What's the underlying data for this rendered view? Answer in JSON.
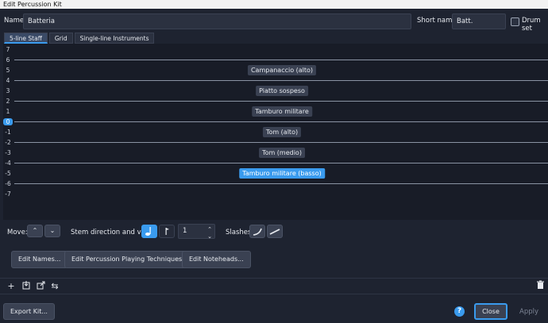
{
  "window": {
    "title": "Edit Percussion Kit"
  },
  "header": {
    "name_label": "Name:",
    "name_value": "Batteria",
    "short_name_label": "Short name:",
    "short_name_value": "Batt.",
    "drum_set_label": "Drum set"
  },
  "tabs": [
    {
      "label": "5-line Staff",
      "active": true
    },
    {
      "label": "Grid",
      "active": false
    },
    {
      "label": "Single-line Instruments",
      "active": false
    }
  ],
  "staff": {
    "row_numbers": [
      "7",
      "6",
      "5",
      "4",
      "3",
      "2",
      "1",
      "0",
      "-1",
      "-2",
      "-3",
      "-4",
      "-5",
      "-6",
      "-7"
    ],
    "selected_row": "0",
    "instruments": [
      {
        "label": "Campanaccio (alto)",
        "selected": false
      },
      {
        "label": "Piatto sospeso",
        "selected": false
      },
      {
        "label": "Tamburo militare",
        "selected": false
      },
      {
        "label": "Tom (alto)",
        "selected": false
      },
      {
        "label": "Tom (medio)",
        "selected": false
      },
      {
        "label": "Tamburo militare (basso)",
        "selected": true
      }
    ]
  },
  "controls": {
    "move_label": "Move:",
    "stem_label": "Stem direction and voice:",
    "voice_value": "1",
    "slashes_label": "Slashes:"
  },
  "edit_buttons": {
    "names": "Edit Names...",
    "techniques": "Edit Percussion Playing Techniques...",
    "noteheads": "Edit Noteheads..."
  },
  "footer": {
    "export": "Export Kit...",
    "help": "?",
    "close": "Close",
    "apply": "Apply"
  },
  "colors": {
    "accent": "#3a9bee",
    "background": "#1e2330",
    "staff_bg": "#181c27"
  }
}
